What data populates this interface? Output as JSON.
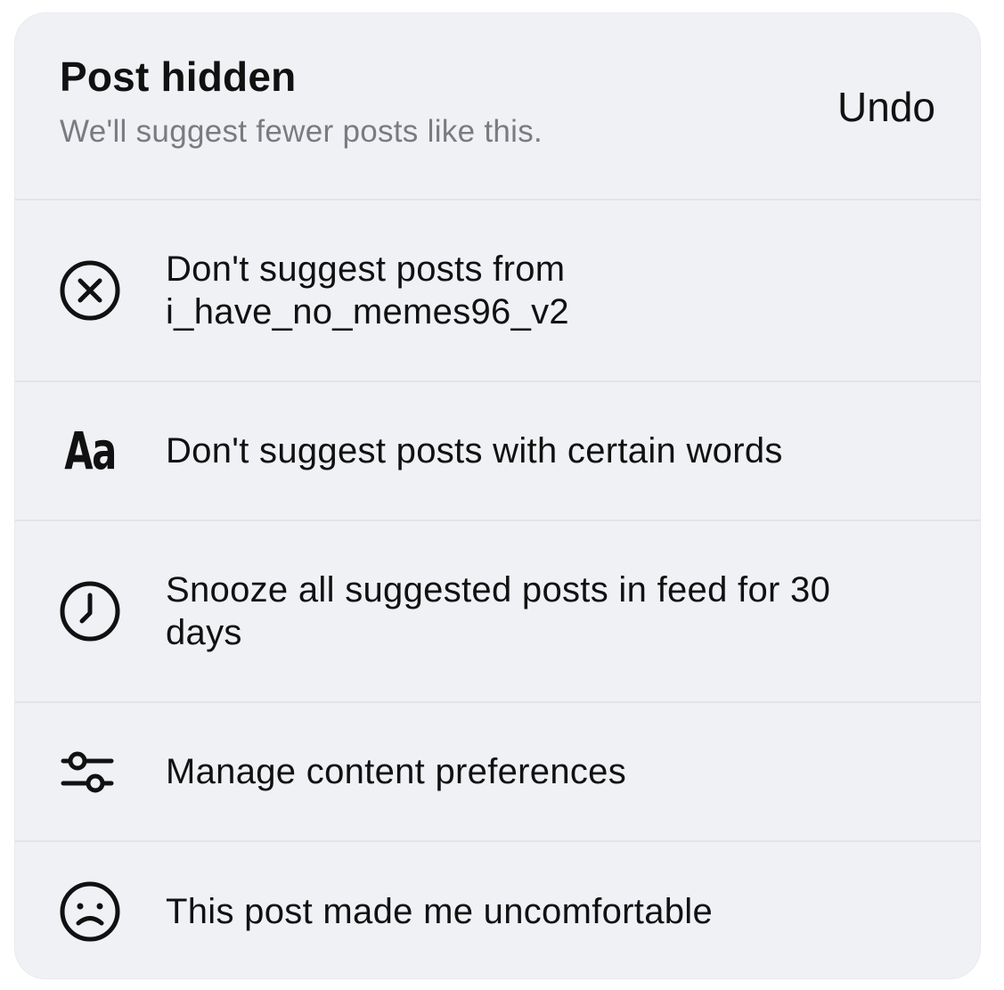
{
  "header": {
    "title": "Post hidden",
    "subtitle": "We'll suggest fewer posts like this.",
    "undo_label": "Undo"
  },
  "options": [
    {
      "label": "Don't suggest posts from i_have_no_memes96_v2",
      "icon": "close-circle-icon"
    },
    {
      "label": "Don't suggest posts with certain words",
      "icon": "text-aa-icon",
      "icon_text": "Aa"
    },
    {
      "label": "Snooze all suggested posts in feed for 30 days",
      "icon": "clock-icon"
    },
    {
      "label": "Manage content preferences",
      "icon": "sliders-icon"
    },
    {
      "label": "This post made me uncomfortable",
      "icon": "sad-face-icon"
    }
  ]
}
